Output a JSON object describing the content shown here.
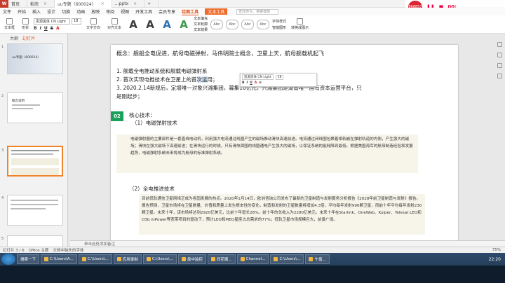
{
  "titlebar": {
    "tabs": [
      {
        "label": "首页",
        "active": false
      },
      {
        "label": "稻壳",
        "active": false
      },
      {
        "label": "uu专题（600024）",
        "active": true
      },
      {
        "label": "…pptx",
        "active": false
      }
    ]
  },
  "menubar": {
    "items": [
      "文件",
      "开始",
      "插入",
      "设计",
      "切换",
      "动画",
      "放映",
      "审阅",
      "视图",
      "开发工具",
      "会员专享"
    ],
    "active_item": "绘图工具",
    "text_tool": "文本工具",
    "search_placeholder": "查找命令、搜索模板"
  },
  "ribbon": {
    "font_name": "思源黑体 CN Light",
    "font_size": "18",
    "buttons": [
      "文本框",
      "形状",
      "文字方向",
      "对齐文本",
      "文本填充",
      "文本轮廓",
      "文本效果",
      "字体样式",
      "智能图形",
      "转换成图示"
    ],
    "big_a_colors": [
      "#3a3a3a",
      "#3a3a3a",
      "#2f6fb3",
      "#3a9a4a"
    ]
  },
  "leftpanel": {
    "tabs": [
      "大纲",
      "幻灯片"
    ],
    "slide_numbers": [
      "1",
      "2",
      "3",
      "4",
      "5",
      "6"
    ],
    "thumb1_title": "uu专题（600024）",
    "thumb2_title": "概念说明"
  },
  "slide": {
    "concept_line": "概念：舰船全电促进，航母电磁弹射，马伟明院士概念，卫星上天，航母舰载机起飞",
    "item1": "1. 舰载全电推动系统和舰载电磁弹射系",
    "item2_pre": "2. 首次实现电推技术在卫星上的首",
    "item2_hl": "次运",
    "item2_post": "用；",
    "item3": "3. 2020.2.14新规后，定增唯一对象兴湘集团，募集10亿元，兴湘集团是湖南唯一国有资本运营平台，只",
    "item3b": "是刚起步；",
    "section_badge": "02",
    "core_title": "核心技术：",
    "sub1": "（1）电磁弹射技术",
    "para1": "电磁弹射器的主要部件是一套直线电动机，利用强大电流通过线圈产生的磁场推动滑块高速前进。电流通过闭线圈包裹着相轨嵌在弹射轨道的内侧，产生强大的磁场；滑块在强大磁场下高速前进；在滑块运行的时候，只有滑块周围的线圈通电产生强大的磁场，以保证系统的能耗降到最低。根据美国海军的航母制造经验和发展趋势，电磁弹射系统未来将成为航母的标准弹射系统。",
    "sub2": "（2）全电推进技术",
    "para2": "目前低轨通信卫星网络正成为各国发展的热点。2020年1月14日，欧洲咨询公司发布了最新的卫星制造与发射服务分析报告《2028年前卫星制造与发射》报告。报告预测，卫星市场将在卫星数量、价值和质量上发生根本性的变化，制造和发射的卫星数量将增加4.3倍，平均每年发射990颗卫星，而前十年平均每年发射230颗卫星。未来十年，该市场将达到2920亿美元，比前十年增长28%。前十年的总收入为2280亿美元。未来十年在Starlink、OneWeb、Kulper、Telesat LEO和O3b mPower等宽带项目的驱动下，预计LEO和MEO星座占总需求的77%；低轨卫星市场规模巨大，前景广阔。"
  },
  "minitoolbar": {
    "font": "思源黑体 CN Light",
    "size": "18"
  },
  "notes": {
    "placeholder": "单击此处添加备注"
  },
  "statusbar": {
    "slide_info": "幻灯片 3 / 6",
    "theme": "Office 主题",
    "font_missing": "文档中缺失的字体",
    "zoom": "75%"
  },
  "taskbar": {
    "start_label": "搜索一下",
    "tasks": [
      "C:\\Users\\A...",
      "C:\\Users\\...",
      "应用录制",
      "C:\\Users\\...",
      "盘中监控",
      "同花顺...",
      "Channel...",
      "C:\\Users\\...",
      "午盘..."
    ],
    "clock": "22:20"
  },
  "overlay": {
    "avatar_text": "868857",
    "time": "00:"
  }
}
